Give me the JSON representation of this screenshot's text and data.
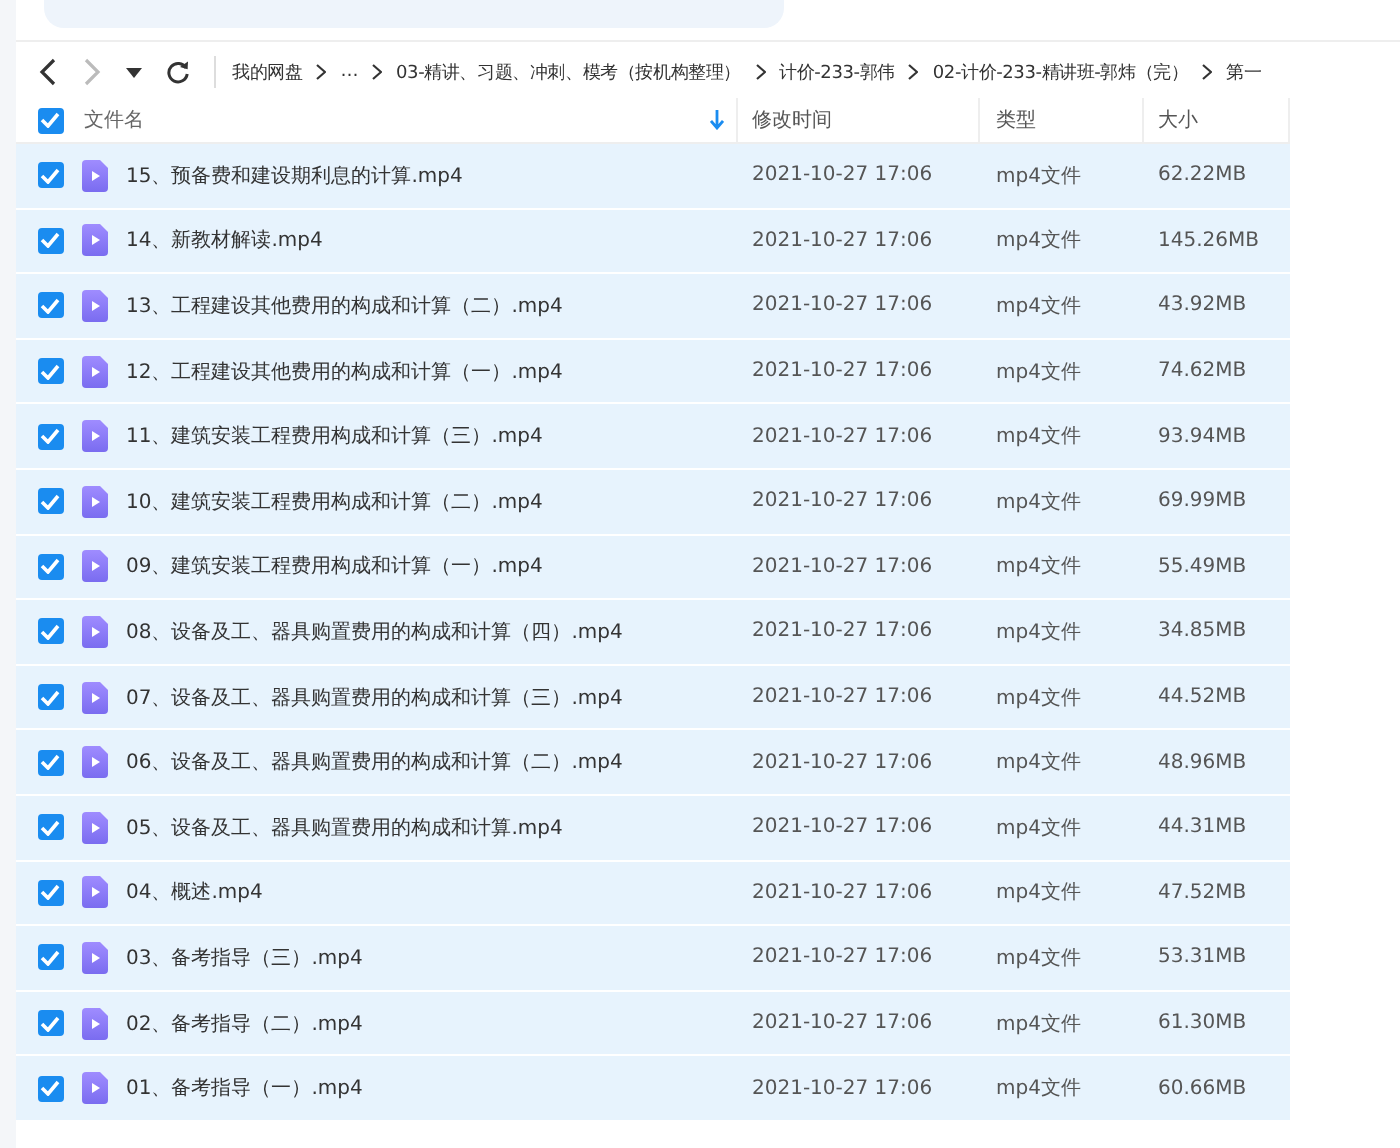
{
  "breadcrumb": [
    "我的网盘",
    "…",
    "03-精讲、习题、冲刺、模考（按机构整理）",
    "计价-233-郭伟",
    "02-计价-233-精讲班-郭炜（完）",
    "第一"
  ],
  "header": {
    "checked": true,
    "columns": [
      "文件名",
      "修改时间",
      "类型",
      "大小"
    ]
  },
  "rows": [
    {
      "name": "15、预备费和建设期利息的计算.mp4",
      "time": "2021-10-27 17:06",
      "type": "mp4文件",
      "size": "62.22MB",
      "checked": true
    },
    {
      "name": "14、新教材解读.mp4",
      "time": "2021-10-27 17:06",
      "type": "mp4文件",
      "size": "145.26MB",
      "checked": true
    },
    {
      "name": "13、工程建设其他费用的构成和计算（二）.mp4",
      "time": "2021-10-27 17:06",
      "type": "mp4文件",
      "size": "43.92MB",
      "checked": true
    },
    {
      "name": "12、工程建设其他费用的构成和计算（一）.mp4",
      "time": "2021-10-27 17:06",
      "type": "mp4文件",
      "size": "74.62MB",
      "checked": true
    },
    {
      "name": "11、建筑安装工程费用构成和计算（三）.mp4",
      "time": "2021-10-27 17:06",
      "type": "mp4文件",
      "size": "93.94MB",
      "checked": true
    },
    {
      "name": "10、建筑安装工程费用构成和计算（二）.mp4",
      "time": "2021-10-27 17:06",
      "type": "mp4文件",
      "size": "69.99MB",
      "checked": true
    },
    {
      "name": "09、建筑安装工程费用构成和计算（一）.mp4",
      "time": "2021-10-27 17:06",
      "type": "mp4文件",
      "size": "55.49MB",
      "checked": true
    },
    {
      "name": "08、设备及工、器具购置费用的构成和计算（四）.mp4",
      "time": "2021-10-27 17:06",
      "type": "mp4文件",
      "size": "34.85MB",
      "checked": true
    },
    {
      "name": "07、设备及工、器具购置费用的构成和计算（三）.mp4",
      "time": "2021-10-27 17:06",
      "type": "mp4文件",
      "size": "44.52MB",
      "checked": true
    },
    {
      "name": "06、设备及工、器具购置费用的构成和计算（二）.mp4",
      "time": "2021-10-27 17:06",
      "type": "mp4文件",
      "size": "48.96MB",
      "checked": true
    },
    {
      "name": "05、设备及工、器具购置费用的构成和计算.mp4",
      "time": "2021-10-27 17:06",
      "type": "mp4文件",
      "size": "44.31MB",
      "checked": true
    },
    {
      "name": "04、概述.mp4",
      "time": "2021-10-27 17:06",
      "type": "mp4文件",
      "size": "47.52MB",
      "checked": true
    },
    {
      "name": "03、备考指导（三）.mp4",
      "time": "2021-10-27 17:06",
      "type": "mp4文件",
      "size": "53.31MB",
      "checked": true
    },
    {
      "name": "02、备考指导（二）.mp4",
      "time": "2021-10-27 17:06",
      "type": "mp4文件",
      "size": "61.30MB",
      "checked": true
    },
    {
      "name": "01、备考指导（一）.mp4",
      "time": "2021-10-27 17:06",
      "type": "mp4文件",
      "size": "60.66MB",
      "checked": true
    }
  ]
}
